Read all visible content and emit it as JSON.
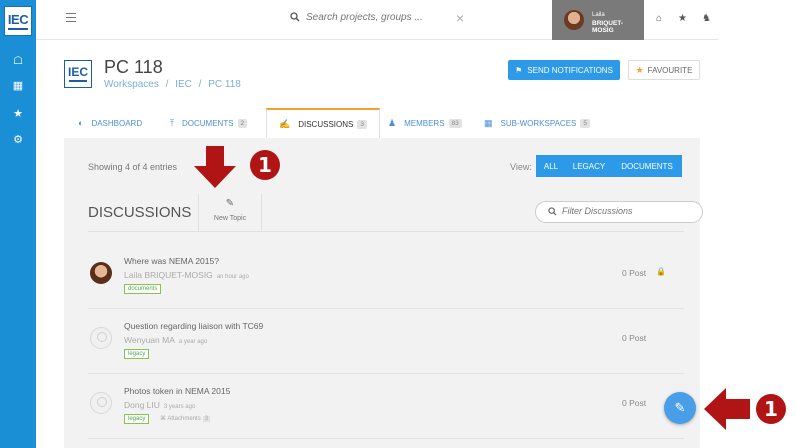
{
  "rail": {
    "logo_text": "IEC",
    "icons": [
      "home-icon",
      "table-icon",
      "star-icon",
      "gear-icon"
    ]
  },
  "topbar": {
    "search_placeholder": "Search projects, groups ...",
    "user_first": "Laila",
    "user_last": "BRIQUET-MOSIG",
    "icons": [
      "home-icon",
      "star-icon",
      "bell-icon"
    ]
  },
  "header": {
    "logo_text": "IEC",
    "title": "PC 118",
    "breadcrumb": [
      "Workspaces",
      "/",
      "IEC",
      "/",
      "PC 118"
    ],
    "send_label": "SEND NOTIFICATIONS",
    "fav_label": "FAVOURITE"
  },
  "tabs": [
    {
      "label": "DASHBOARD",
      "badge": ""
    },
    {
      "label": "DOCUMENTS",
      "badge": "2"
    },
    {
      "label": "DISCUSSIONS",
      "badge": "3"
    },
    {
      "label": "MEMBERS",
      "badge": "83"
    },
    {
      "label": "SUB-WORKSPACES",
      "badge": "5"
    }
  ],
  "panel": {
    "showing": "Showing 4 of 4 entries",
    "view_label": "View:",
    "view_options": [
      "ALL",
      "LEGACY",
      "DOCUMENTS"
    ],
    "section_title": "DISCUSSIONS",
    "new_topic": "New Topic",
    "filter_placeholder": "Filter Discussions"
  },
  "discussions": [
    {
      "title": "Where was NEMA 2015?",
      "author": "Laila BRIQUET-MOSIG",
      "time": "an hour ago",
      "tag": "documents",
      "posts": "0 Post",
      "attachments": "",
      "locked": true
    },
    {
      "title": "Question regarding liaison with TC69",
      "author": "Wenyuan MA",
      "time": "a year ago",
      "tag": "legacy",
      "posts": "0 Post",
      "attachments": "",
      "locked": false
    },
    {
      "title": "Photos token in NEMA 2015",
      "author": "Dong LIU",
      "time": "3 years ago",
      "tag": "legacy",
      "posts": "0 Post",
      "attachments_label": "Attachments",
      "attachments": "3",
      "locked": false
    }
  ],
  "annotations": {
    "marker": "1"
  },
  "colors": {
    "accent": "#2c9ae8",
    "rail": "#1a8fd6",
    "active_tab": "#f2a12c",
    "annotation": "#b01414"
  }
}
